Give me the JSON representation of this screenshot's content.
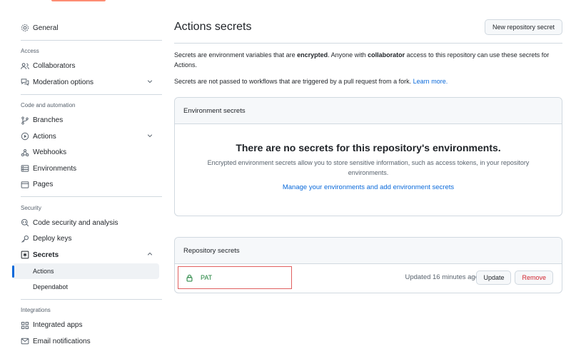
{
  "sidebar": {
    "general": "General",
    "sections": {
      "access": "Access",
      "code_automation": "Code and automation",
      "security": "Security",
      "integrations": "Integrations"
    },
    "access_items": [
      "Collaborators",
      "Moderation options"
    ],
    "code_items": [
      "Branches",
      "Actions",
      "Webhooks",
      "Environments",
      "Pages"
    ],
    "security_items": [
      "Code security and analysis",
      "Deploy keys",
      "Secrets"
    ],
    "secrets_sub": [
      "Actions",
      "Dependabot"
    ],
    "integration_items": [
      "Integrated apps",
      "Email notifications"
    ],
    "active_sub": "Actions"
  },
  "main": {
    "title": "Actions secrets",
    "new_secret_button": "New repository secret",
    "desc1": {
      "a": "Secrets are environment variables that are ",
      "b": "encrypted",
      "c": ". Anyone with ",
      "d": "collaborator",
      "e": " access to this repository can use these secrets for Actions."
    },
    "desc2": {
      "a": "Secrets are not passed to workflows that are triggered by a pull request from a fork. ",
      "link": "Learn more."
    },
    "environment_secrets": {
      "header": "Environment secrets",
      "empty_title": "There are no secrets for this repository's environments.",
      "empty_desc": "Encrypted environment secrets allow you to store sensitive information, such as access tokens, in your repository environments.",
      "manage_link": "Manage your environments and add environment secrets"
    },
    "repository_secrets": {
      "header": "Repository secrets",
      "rows": [
        {
          "name": "PAT",
          "updated": "Updated 16 minutes ago",
          "update_label": "Update",
          "remove_label": "Remove"
        }
      ]
    }
  },
  "colors": {
    "accent": "#0969da",
    "success": "#1a7f37",
    "danger": "#d1242f",
    "tab_underline": "#fd8c73"
  }
}
